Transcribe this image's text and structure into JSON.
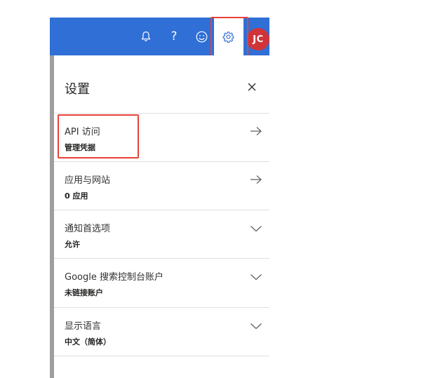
{
  "topbar": {
    "icons": [
      "bell-icon",
      "help-icon",
      "smiley-icon",
      "gear-icon"
    ],
    "help_glyph": "?",
    "avatar_initials": "JC",
    "avatar_color": "#d13438",
    "bar_color": "#2f6fd6"
  },
  "panel": {
    "title": "设置",
    "items": [
      {
        "title": "API 访问",
        "subtitle": "管理凭据",
        "icon": "arrow-right-icon"
      },
      {
        "title": "应用与网站",
        "subtitle": "0 应用",
        "icon": "arrow-right-icon"
      },
      {
        "title": "通知首选项",
        "subtitle": "允许",
        "icon": "chevron-down-icon"
      },
      {
        "title": "Google 搜索控制台账户",
        "subtitle": "未链接账户",
        "icon": "chevron-down-icon"
      },
      {
        "title": "显示语言",
        "subtitle": "中文（简体）",
        "icon": "chevron-down-icon"
      }
    ]
  },
  "highlight_color": "#e8413a"
}
